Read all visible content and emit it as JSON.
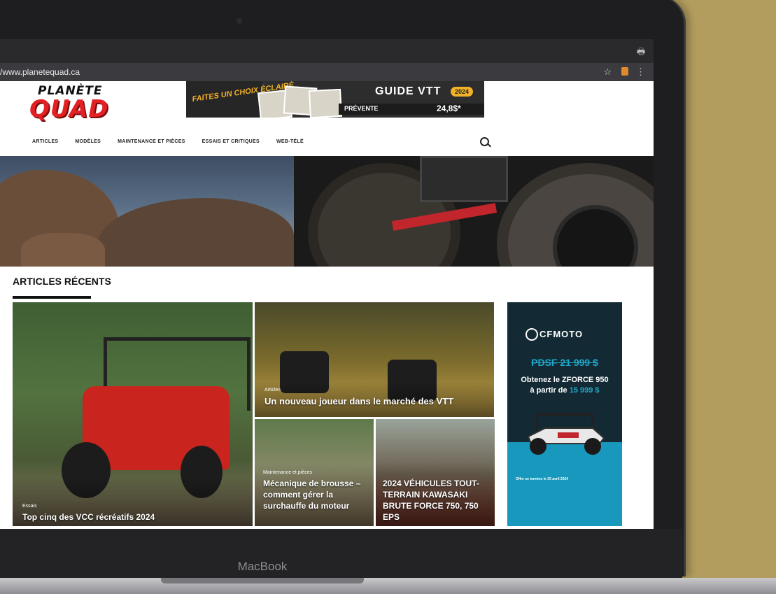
{
  "browser": {
    "url": "/www.planetequad.ca"
  },
  "device": {
    "label": "MacBook"
  },
  "site": {
    "logo_top": "PLANÈTE",
    "logo_main": "QUAD",
    "nav": [
      "ARTICLES",
      "MODÈLES",
      "MAINTENANCE ET PIÈCES",
      "ESSAIS ET CRITIQUES",
      "WEB-TÉLÉ"
    ]
  },
  "banner": {
    "script": "FAITES UN CHOIX ÉCLAIRÉ",
    "title": "GUIDE VTT",
    "year": "2024",
    "presale": "PRÉVENTE",
    "price": "24,8$*"
  },
  "section": {
    "title": "ARTICLES RÉCENTS"
  },
  "articles": [
    {
      "category": "Essais",
      "title": "Top cinq des VCC récréatifs 2024"
    },
    {
      "category": "Articles",
      "title": "Un nouveau joueur dans le marché des VTT"
    },
    {
      "category": "Maintenance et pièces",
      "title": "Mécanique de brousse – comment gérer la surchauffe du moteur"
    },
    {
      "category": "",
      "title": "2024 VÉHICULES TOUT-TERRAIN KAWASAKI BRUTE FORCE 750, 750 EPS"
    }
  ],
  "ad": {
    "brand": "CFMOTO",
    "old_price": "PDSF 21 999 $",
    "line1": "Obtenez le ZFORCE 950",
    "line2_prefix": "à partir de ",
    "new_price": "15 999 $",
    "fine": "Offre se termine le 30 avril 2024"
  },
  "colors": {
    "brand_red": "#e32024",
    "banner_gold": "#f2b126",
    "ad_teal": "#1898bc"
  }
}
